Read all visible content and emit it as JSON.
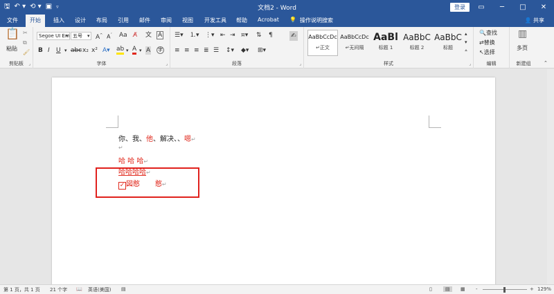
{
  "titlebar": {
    "title": "文档2 - Word",
    "login_label": "登录",
    "qat_icons": [
      "save-icon",
      "undo-icon",
      "redo-icon",
      "touch-mode-icon",
      "customize-icon"
    ],
    "window_controls": [
      "─",
      "□",
      "✕"
    ],
    "ribbon_display_glyph": "▭"
  },
  "tabs": [
    "文件",
    "开始",
    "插入",
    "设计",
    "布局",
    "引用",
    "邮件",
    "审阅",
    "视图",
    "开发工具",
    "帮助",
    "Acrobat",
    "操作说明搜索"
  ],
  "active_tab": "开始",
  "share_label": "共享",
  "ribbon": {
    "clipboard": {
      "label": "剪贴板",
      "paste_label": "粘贴"
    },
    "font": {
      "label": "字体",
      "font_name": "Segoe UI Em",
      "font_size": "五号"
    },
    "paragraph": {
      "label": "段落"
    },
    "styles": {
      "label": "样式",
      "items": [
        {
          "preview": "AaBbCcDc",
          "name": "正文"
        },
        {
          "preview": "AaBbCcDc",
          "name": "无间隔"
        },
        {
          "preview": "AaBl",
          "name": "标题 1"
        },
        {
          "preview": "AaBbC",
          "name": "标题 2"
        },
        {
          "preview": "AaBbC",
          "name": "标题"
        }
      ]
    },
    "editing": {
      "label": "编辑",
      "find": "查找",
      "replace": "替换",
      "select": "选择"
    },
    "new_group": {
      "label": "新建组",
      "multipage": "多页"
    }
  },
  "document": {
    "line1": {
      "a": "你、我、",
      "b": "他",
      "c": "、解决、、",
      "d": "嗯",
      "mark": "↵"
    },
    "line2": {
      "mark": "↵"
    },
    "line3": {
      "text": "哈 哈 哈",
      "mark": "↵"
    },
    "line4": {
      "text": "哈哈哈哈",
      "mark": "↵"
    },
    "line5": {
      "check": "✓",
      "a": "図憨",
      "b": "憨",
      "mark": "↵"
    }
  },
  "status": {
    "page": "第 1 页，共 1 页",
    "words": "21 个字",
    "language": "英语(美国)",
    "zoom": "129%",
    "zoom_minus": "-",
    "zoom_plus": "+"
  },
  "colors": {
    "accent": "#2b579a",
    "red_text": "#e0281c",
    "highlight_box": "#e0201c"
  }
}
